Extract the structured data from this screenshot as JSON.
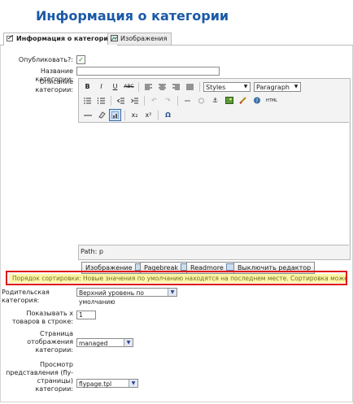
{
  "page_title": "Информация о категории",
  "tabs": [
    {
      "label": "Информация о категории",
      "active": true
    },
    {
      "label": "Изображения",
      "active": false
    }
  ],
  "form": {
    "publish_label": "Опубликовать?:",
    "publish_checked": true,
    "name_label": "Название категории:",
    "name_value": "",
    "desc_label": "Описание категории:",
    "parent_label": "Родительская категория:",
    "parent_value": "Верхний уровень по умолчанию",
    "perrow_label": "Показывать x товаров в строке:",
    "perrow_value": "1",
    "browse_label": "Страница отображения категории:",
    "browse_value": "managed",
    "flypage_label": "Просмотр представления (fly-страницы) категории:",
    "flypage_value": "flypage.tpl"
  },
  "editor": {
    "styles_value": "Styles",
    "format_value": "Paragraph",
    "path_text": "Path: p",
    "toolbar_labels": {
      "bold": "B",
      "italic": "I",
      "underline": "U",
      "strike": "ABC",
      "sub": "x₂",
      "sup": "x²",
      "omega": "Ω",
      "html": "HTML"
    }
  },
  "editor_buttons": [
    {
      "label": "Изображение"
    },
    {
      "label": "Pagebreak"
    },
    {
      "label": "Readmore"
    },
    {
      "label": "Выключить редактор"
    }
  ],
  "notice": {
    "text": "Порядок сортировки:  Новые значения по умолчанию находятся на последнем месте. Сортировка может быть изменена"
  }
}
